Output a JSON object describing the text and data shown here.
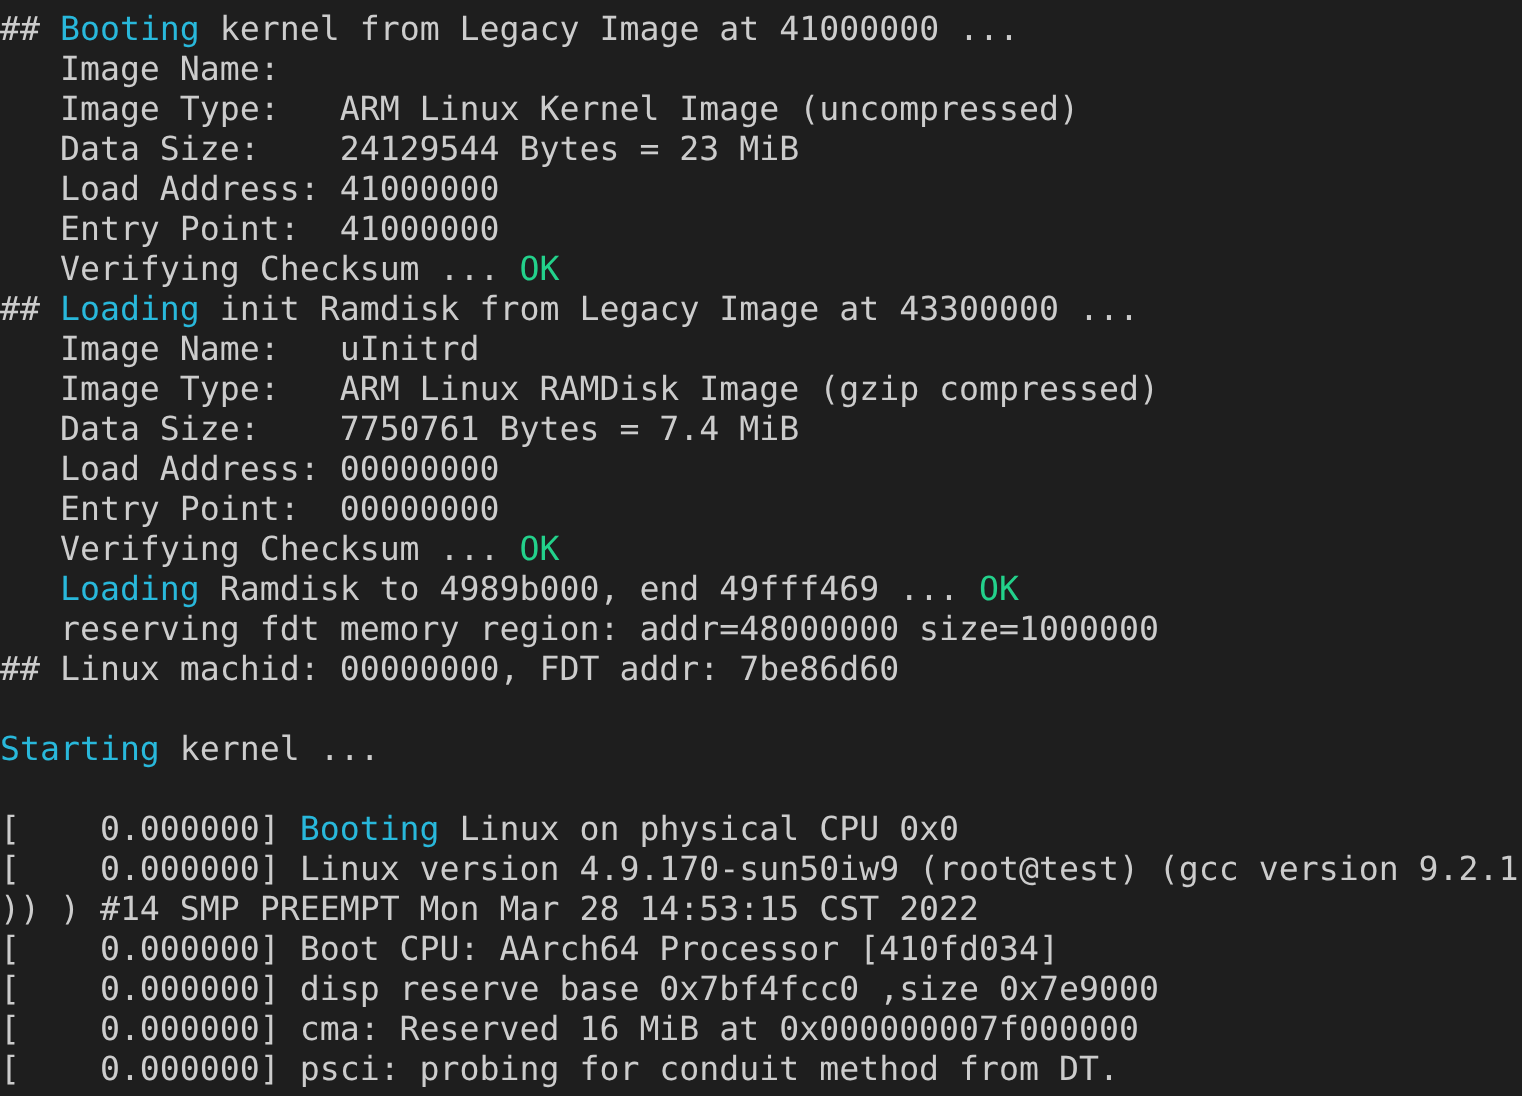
{
  "terminal": {
    "lines": [
      {
        "kind": "text",
        "segments": [
          {
            "kind": "text",
            "text": "## "
          },
          {
            "kind": "accent",
            "text": "Booting"
          },
          {
            "kind": "text",
            "text": " kernel from Legacy Image at 41000000 ..."
          }
        ]
      },
      {
        "kind": "text",
        "segments": [
          {
            "kind": "text",
            "text": "   Image Name:"
          }
        ]
      },
      {
        "kind": "text",
        "segments": [
          {
            "kind": "text",
            "text": "   Image Type:   ARM Linux Kernel Image (uncompressed)"
          }
        ]
      },
      {
        "kind": "text",
        "segments": [
          {
            "kind": "text",
            "text": "   Data Size:    24129544 Bytes = 23 MiB"
          }
        ]
      },
      {
        "kind": "text",
        "segments": [
          {
            "kind": "text",
            "text": "   Load Address: 41000000"
          }
        ]
      },
      {
        "kind": "text",
        "segments": [
          {
            "kind": "text",
            "text": "   Entry Point:  41000000"
          }
        ]
      },
      {
        "kind": "text",
        "segments": [
          {
            "kind": "text",
            "text": "   Verifying Checksum ... "
          },
          {
            "kind": "ok",
            "text": "OK"
          }
        ]
      },
      {
        "kind": "text",
        "segments": [
          {
            "kind": "text",
            "text": "## "
          },
          {
            "kind": "accent",
            "text": "Loading"
          },
          {
            "kind": "text",
            "text": " init Ramdisk from Legacy Image at 43300000 ..."
          }
        ]
      },
      {
        "kind": "text",
        "segments": [
          {
            "kind": "text",
            "text": "   Image Name:   uInitrd"
          }
        ]
      },
      {
        "kind": "text",
        "segments": [
          {
            "kind": "text",
            "text": "   Image Type:   ARM Linux RAMDisk Image (gzip compressed)"
          }
        ]
      },
      {
        "kind": "text",
        "segments": [
          {
            "kind": "text",
            "text": "   Data Size:    7750761 Bytes = 7.4 MiB"
          }
        ]
      },
      {
        "kind": "text",
        "segments": [
          {
            "kind": "text",
            "text": "   Load Address: 00000000"
          }
        ]
      },
      {
        "kind": "text",
        "segments": [
          {
            "kind": "text",
            "text": "   Entry Point:  00000000"
          }
        ]
      },
      {
        "kind": "text",
        "segments": [
          {
            "kind": "text",
            "text": "   Verifying Checksum ... "
          },
          {
            "kind": "ok",
            "text": "OK"
          }
        ]
      },
      {
        "kind": "indented",
        "segments": [
          {
            "kind": "accent",
            "text": "Loading"
          },
          {
            "kind": "text",
            "text": " Ramdisk to 4989b000, end 49fff469 ... "
          },
          {
            "kind": "ok",
            "text": "OK"
          }
        ]
      },
      {
        "kind": "text",
        "segments": [
          {
            "kind": "text",
            "text": "   reserving fdt memory region: addr=48000000 size=1000000"
          }
        ]
      },
      {
        "kind": "text",
        "segments": [
          {
            "kind": "text",
            "text": "## Linux machid: 00000000, FDT addr: 7be86d60"
          }
        ]
      },
      {
        "kind": "blank"
      },
      {
        "kind": "text",
        "segments": [
          {
            "kind": "accent",
            "text": "Starting"
          },
          {
            "kind": "text",
            "text": " kernel ..."
          }
        ]
      },
      {
        "kind": "blank"
      },
      {
        "kind": "text",
        "segments": [
          {
            "kind": "text",
            "text": "[    0.000000] "
          },
          {
            "kind": "accent",
            "text": "Booting"
          },
          {
            "kind": "text",
            "text": " Linux on physical CPU 0x0"
          }
        ]
      },
      {
        "kind": "text",
        "segments": [
          {
            "kind": "text",
            "text": "[    0.000000] Linux version 4.9.170-sun50iw9 (root@test) (gcc version 9.2.1"
          }
        ]
      },
      {
        "kind": "text",
        "segments": [
          {
            "kind": "text",
            "text": ")) ) #14 SMP PREEMPT Mon Mar 28 14:53:15 CST 2022"
          }
        ]
      },
      {
        "kind": "text",
        "segments": [
          {
            "kind": "text",
            "text": "[    0.000000] Boot CPU: AArch64 Processor [410fd034]"
          }
        ]
      },
      {
        "kind": "text",
        "segments": [
          {
            "kind": "text",
            "text": "[    0.000000] disp reserve base 0x7bf4fcc0 ,size 0x7e9000"
          }
        ]
      },
      {
        "kind": "text",
        "segments": [
          {
            "kind": "text",
            "text": "[    0.000000] cma: Reserved 16 MiB at 0x000000007f000000"
          }
        ]
      },
      {
        "kind": "text",
        "segments": [
          {
            "kind": "text",
            "text": "[    0.000000] psci: probing for conduit method from DT."
          }
        ]
      }
    ]
  }
}
